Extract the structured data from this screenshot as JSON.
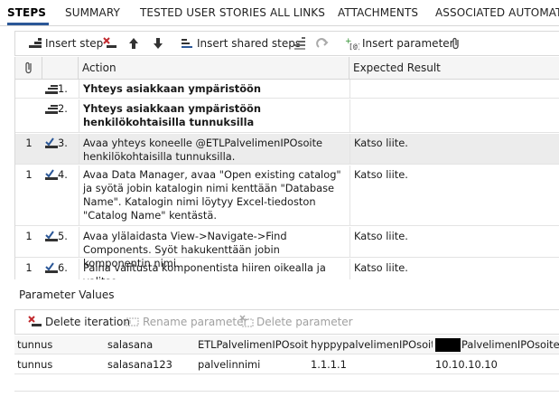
{
  "tabs": [
    "STEPS",
    "SUMMARY",
    "TESTED USER STORIES",
    "ALL LINKS",
    "ATTACHMENTS",
    "ASSOCIATED AUTOMATIC"
  ],
  "toolbar": {
    "insert_step": "Insert step",
    "insert_shared_steps": "Insert shared steps",
    "insert_parameter": "Insert parameter"
  },
  "grid": {
    "headers": {
      "attachment": "",
      "action": "Action",
      "expected": "Expected Result"
    },
    "rows": [
      {
        "att": "",
        "num": "1.",
        "action": "Yhteys asiakkaan ympäristöön",
        "expected": "",
        "shared": true
      },
      {
        "att": "",
        "num": "2.",
        "action": "Yhteys asiakkaan ympäristöön henkilökohtaisilla tunnuksilla",
        "expected": "",
        "shared": true
      },
      {
        "att": "1",
        "num": "3.",
        "action": "Avaa yhteys koneelle @ETLPalvelimenIPOsoite henkilökohtaisilla tunnuksilla.",
        "expected": "Katso liite.",
        "shared": false
      },
      {
        "att": "1",
        "num": "4.",
        "action": "Avaa Data Manager, avaa \"Open existing catalog\" ja syötä jobin katalogin nimi kenttään \"Database Name\". Katalogin nimi löytyy Excel-tiedoston \"Catalog Name\" kentästä.",
        "expected": "Katso liite.",
        "shared": false
      },
      {
        "att": "1",
        "num": "5.",
        "action": "Avaa ylälaidasta View->Navigate->Find Components. Syöt hakukenttään jobin komponentin nimi.",
        "expected": "Katso liite.",
        "shared": false
      },
      {
        "att": "1",
        "num": "6.",
        "action": "Paina valitusta komponentista hiiren oikealla ja valitse",
        "expected": "Katso liite.",
        "shared": false
      }
    ]
  },
  "parameter_values": {
    "title": "Parameter Values",
    "toolbar": {
      "delete_iteration": "Delete iteration",
      "rename_parameter": "Rename parameter",
      "delete_parameter": "Delete parameter"
    },
    "columns": [
      "tunnus",
      "salasana",
      "ETLPalvelimenIPOsoite",
      "hyppypalvelimenIPOsoite",
      "PalvelimenIPOsoite"
    ],
    "values": [
      "tunnus",
      "salasana123",
      "palvelinnimi",
      "1.1.1.1",
      "10.10.10.10"
    ]
  }
}
